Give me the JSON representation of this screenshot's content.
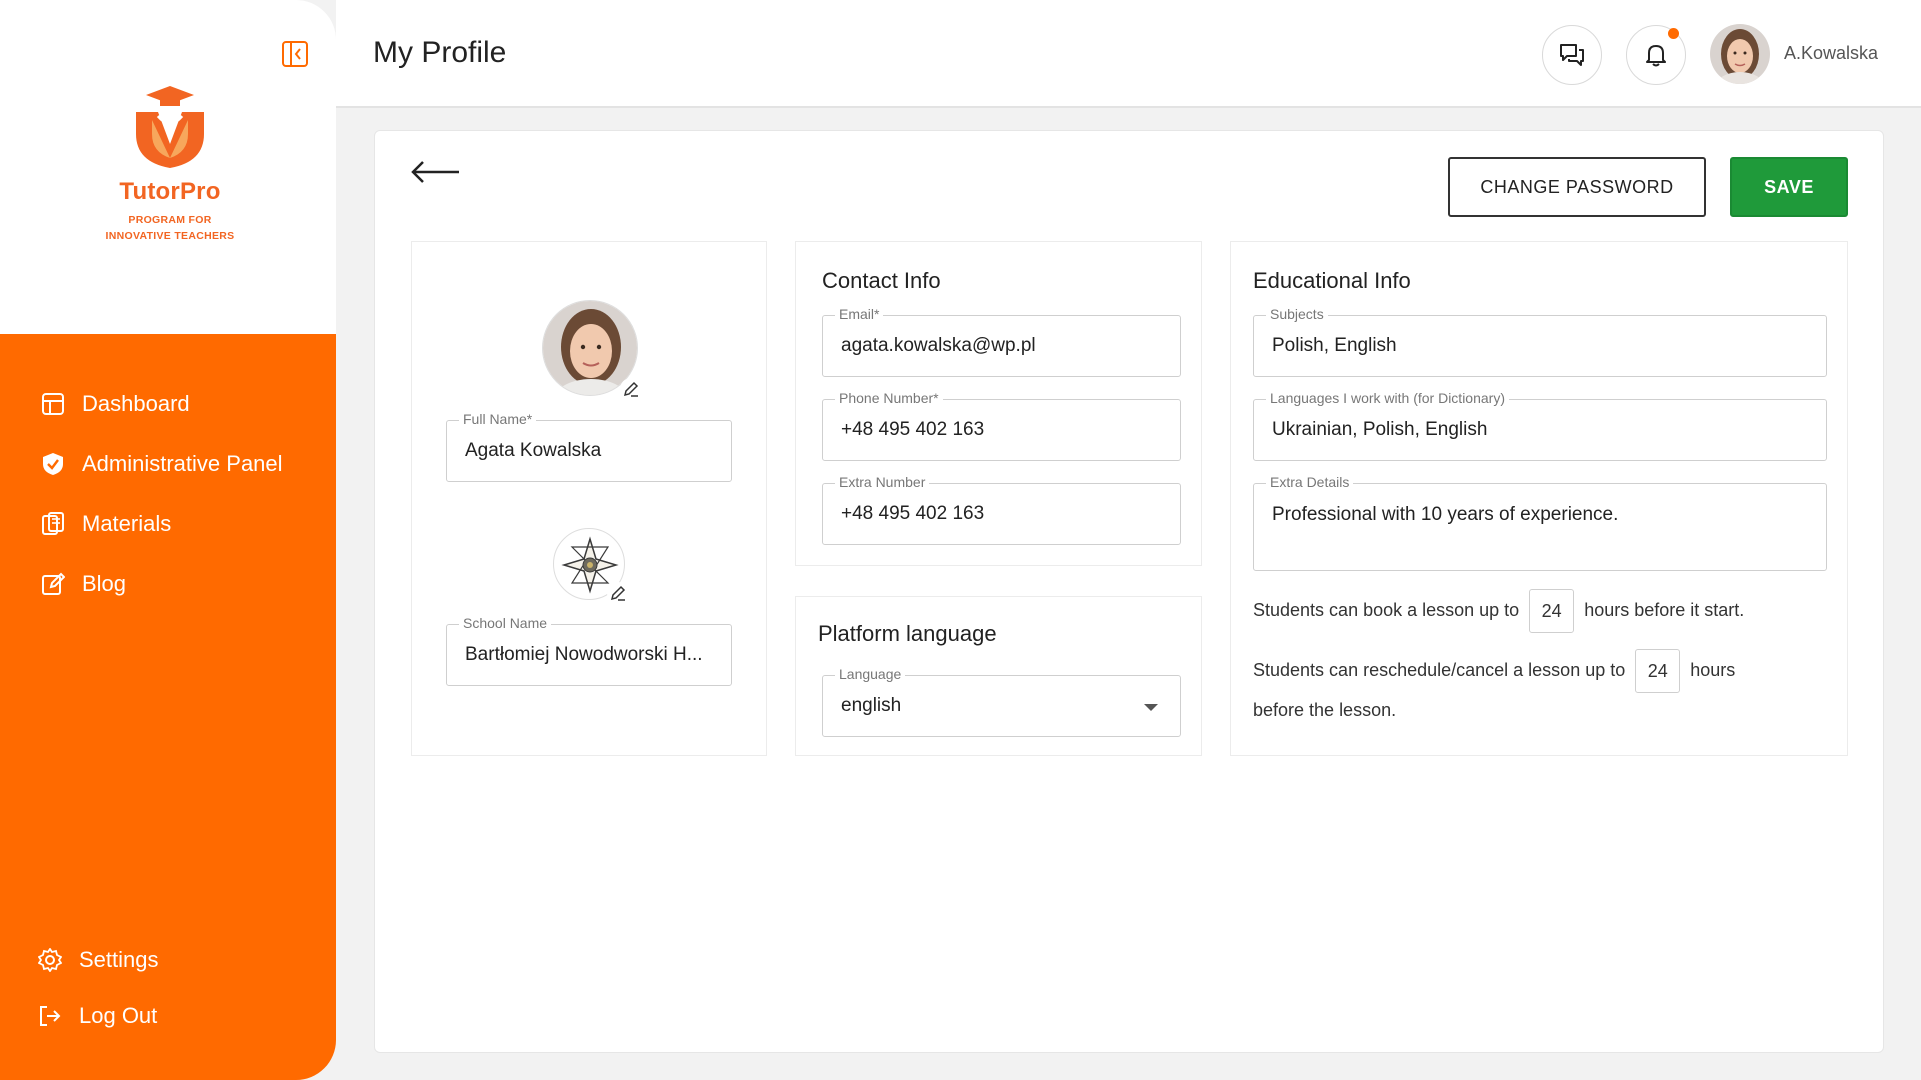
{
  "brand": {
    "name": "TutorPro",
    "tagline_line1": "PROGRAM FOR",
    "tagline_line2": "INNOVATIVE TEACHERS",
    "accent": "#ff6a00"
  },
  "sidebar": {
    "items": [
      {
        "label": "Dashboard",
        "icon": "dashboard-icon"
      },
      {
        "label": "Administrative Panel",
        "icon": "shield-icon"
      },
      {
        "label": "Materials",
        "icon": "materials-icon"
      },
      {
        "label": "Blog",
        "icon": "edit-icon"
      }
    ],
    "bottom": [
      {
        "label": "Settings",
        "icon": "gear-icon"
      },
      {
        "label": "Log Out",
        "icon": "logout-icon"
      }
    ]
  },
  "header": {
    "title": "My Profile",
    "username": "A.Kowalska"
  },
  "actions": {
    "change_password": "CHANGE PASSWORD",
    "save": "SAVE",
    "save_color": "#1f9a3a"
  },
  "profile": {
    "full_name_label": "Full Name*",
    "full_name": "Agata Kowalska",
    "school_label": "School Name",
    "school_name": "Bartłomiej Nowodworski H..."
  },
  "contact": {
    "title": "Contact Info",
    "email_label": "Email*",
    "email": "agata.kowalska@wp.pl",
    "phone_label": "Phone Number*",
    "phone": "+48 495 402 163",
    "extra_label": "Extra Number",
    "extra": "+48 495 402 163"
  },
  "platform": {
    "title": "Platform language",
    "language_label": "Language",
    "language": "english"
  },
  "education": {
    "title": "Educational Info",
    "subjects_label": "Subjects",
    "subjects": "Polish, English",
    "languages_label": "Languages I work with (for Dictionary)",
    "languages": "Ukrainian, Polish, English",
    "details_label": "Extra Details",
    "details": "Professional with 10 years of experience.",
    "book_prefix": "Students can book a lesson up to",
    "book_hours": "24",
    "book_suffix": "hours before it start.",
    "resched_prefix": "Students can reschedule/cancel a lesson up to",
    "resched_hours": "24",
    "resched_suffix": "hours",
    "resched_tail": "before the lesson."
  }
}
